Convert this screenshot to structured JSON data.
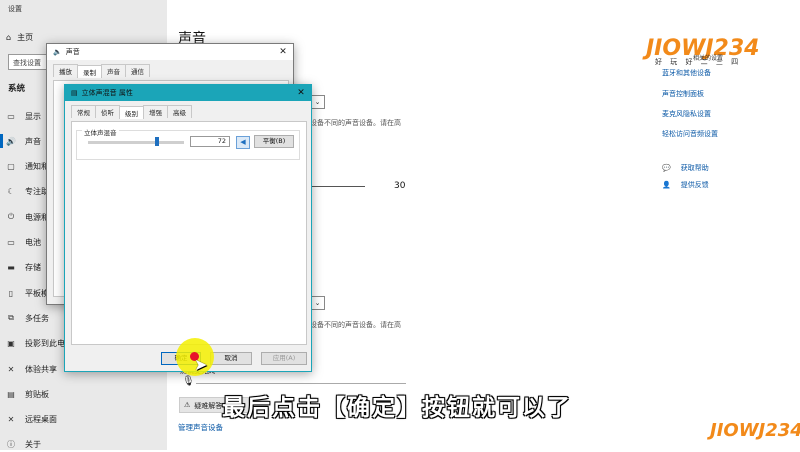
{
  "settings": {
    "window_title": "设置",
    "home": "主页",
    "search_placeholder": "查找设置",
    "section": "系统",
    "nav": [
      {
        "icon": "monitor-icon",
        "label": "显示"
      },
      {
        "icon": "speaker-icon",
        "label": "声音"
      },
      {
        "icon": "notification-icon",
        "label": "通知和"
      },
      {
        "icon": "focus-icon",
        "label": "专注助"
      },
      {
        "icon": "power-icon",
        "label": "电源和"
      },
      {
        "icon": "battery-icon",
        "label": "电池"
      },
      {
        "icon": "storage-icon",
        "label": "存储"
      },
      {
        "icon": "tablet-icon",
        "label": "平板模"
      },
      {
        "icon": "multitask-icon",
        "label": "多任务"
      },
      {
        "icon": "project-icon",
        "label": "投影到此电脑"
      },
      {
        "icon": "share-icon",
        "label": "体验共享"
      },
      {
        "icon": "clipboard-icon",
        "label": "剪贴板"
      },
      {
        "icon": "remote-icon",
        "label": "远程桌面"
      },
      {
        "icon": "info-icon",
        "label": "关于"
      }
    ],
    "page_title": "声音",
    "output_desc": "设备不同的声音设备。请在高",
    "volume": "30",
    "input_desc": "设备不同的声音设备。请在高",
    "mic_label": "测试麦克风",
    "troubleshoot": "疑难解答",
    "manage_link": "管理声音设备",
    "related_links": [
      "蓝牙和其他设备",
      "声音控制面板",
      "麦克风隐私设置",
      "轻松访问音频设置"
    ],
    "help": [
      {
        "icon": "chat-icon",
        "label": "获取帮助"
      },
      {
        "icon": "feedback-icon",
        "label": "提供反馈"
      }
    ]
  },
  "sound_dialog": {
    "title": "声音",
    "tabs": [
      "播放",
      "录制",
      "声音",
      "通信"
    ],
    "active_tab": "录制"
  },
  "props_dialog": {
    "title": "立体声混音 属性",
    "tabs": [
      "常规",
      "侦听",
      "级别",
      "增强",
      "高级"
    ],
    "active_tab": "级别",
    "group_label": "立体声混音",
    "level_value": "72",
    "level_fraction": 0.72,
    "balance_button": "平衡(B)",
    "ok_button": "确定",
    "cancel_button": "取消",
    "apply_button": "应用(A)"
  },
  "overlay": {
    "subtitle": "最后点击【确定】按钮就可以了",
    "logo_text": "JIOWJ234",
    "logo_sub": "好 玩 好 二 三 四",
    "logo_small": "相关的设置"
  },
  "colors": {
    "accent": "#0067c0",
    "dialog_title": "#1ba5b8",
    "link": "#0a58a6"
  }
}
